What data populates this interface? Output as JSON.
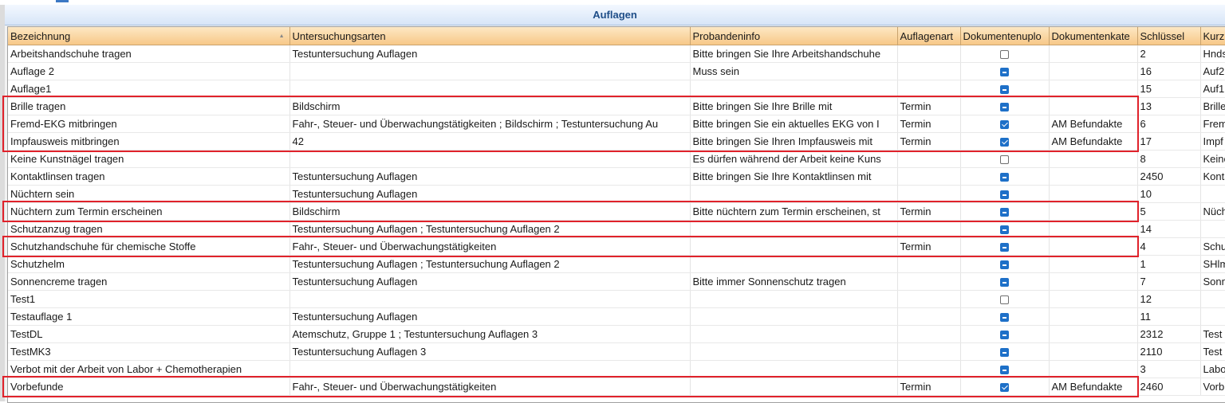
{
  "panel": {
    "title": "Auflagen"
  },
  "columns": [
    "Bezeichnung",
    "Untersuchungsarten",
    "Probandeninfo",
    "Auflagenart",
    "Dokumentenuplo",
    "Dokumentenkate",
    "Schlüssel",
    "Kurz"
  ],
  "sort": {
    "column": "Bezeichnung",
    "direction": "ascending"
  },
  "colors": {
    "highlight_border": "#e0222b",
    "header_bg": "#f7c888",
    "checkbox_accent": "#1e70c8"
  },
  "rows": [
    {
      "bezeichnung": "Arbeitshandschuhe tragen",
      "untersuchungsarten": "Testuntersuchung Auflagen",
      "probandeninfo": "Bitte bringen Sie Ihre Arbeitshandschuhe",
      "auflagenart": "",
      "upload": "unchecked",
      "kategorie": "",
      "schluessel": "2",
      "kurz": "Hnds",
      "highlighted": false
    },
    {
      "bezeichnung": "Auflage 2",
      "untersuchungsarten": "",
      "probandeninfo": "Muss sein",
      "auflagenart": "",
      "upload": "indeterminate",
      "kategorie": "",
      "schluessel": "16",
      "kurz": "Auf2",
      "highlighted": false
    },
    {
      "bezeichnung": "Auflage1",
      "untersuchungsarten": "",
      "probandeninfo": "",
      "auflagenart": "",
      "upload": "indeterminate",
      "kategorie": "",
      "schluessel": "15",
      "kurz": "Auf1",
      "highlighted": false
    },
    {
      "bezeichnung": "Brille tragen",
      "untersuchungsarten": "Bildschirm",
      "probandeninfo": "Bitte bringen Sie Ihre Brille mit",
      "auflagenart": "Termin",
      "upload": "indeterminate",
      "kategorie": "",
      "schluessel": "13",
      "kurz": "Brille",
      "highlighted": true
    },
    {
      "bezeichnung": "Fremd-EKG mitbringen",
      "untersuchungsarten": "Fahr-, Steuer- und Überwachungstätigkeiten ; Bildschirm ; Testuntersuchung Au",
      "probandeninfo": "Bitte bringen Sie ein aktuelles EKG von I",
      "auflagenart": "Termin",
      "upload": "checked",
      "kategorie": "AM Befundakte",
      "schluessel": "6",
      "kurz": "Frem",
      "highlighted": true
    },
    {
      "bezeichnung": "Impfausweis mitbringen",
      "untersuchungsarten": "42",
      "probandeninfo": "Bitte bringen Sie Ihren Impfausweis mit",
      "auflagenart": "Termin",
      "upload": "checked",
      "kategorie": "AM Befundakte",
      "schluessel": "17",
      "kurz": "Impf",
      "highlighted": true
    },
    {
      "bezeichnung": "Keine Kunstnägel tragen",
      "untersuchungsarten": "",
      "probandeninfo": "Es dürfen während der Arbeit keine Kuns",
      "auflagenart": "",
      "upload": "unchecked",
      "kategorie": "",
      "schluessel": "8",
      "kurz": "Keine",
      "highlighted": false
    },
    {
      "bezeichnung": "Kontaktlinsen tragen",
      "untersuchungsarten": "Testuntersuchung Auflagen",
      "probandeninfo": "Bitte bringen Sie Ihre Kontaktlinsen mit",
      "auflagenart": "",
      "upload": "indeterminate",
      "kategorie": "",
      "schluessel": "2450",
      "kurz": "Konta",
      "highlighted": false
    },
    {
      "bezeichnung": "Nüchtern sein",
      "untersuchungsarten": "Testuntersuchung Auflagen",
      "probandeninfo": "",
      "auflagenart": "",
      "upload": "indeterminate",
      "kategorie": "",
      "schluessel": "10",
      "kurz": "",
      "highlighted": false
    },
    {
      "bezeichnung": "Nüchtern zum Termin erscheinen",
      "untersuchungsarten": "Bildschirm",
      "probandeninfo": "Bitte nüchtern zum Termin erscheinen, st",
      "auflagenart": "Termin",
      "upload": "indeterminate",
      "kategorie": "",
      "schluessel": "5",
      "kurz": "Nüch",
      "highlighted": true
    },
    {
      "bezeichnung": "Schutzanzug tragen",
      "untersuchungsarten": "Testuntersuchung Auflagen ; Testuntersuchung Auflagen 2",
      "probandeninfo": "",
      "auflagenart": "",
      "upload": "indeterminate",
      "kategorie": "",
      "schluessel": "14",
      "kurz": "",
      "highlighted": false
    },
    {
      "bezeichnung": "Schutzhandschuhe für chemische Stoffe",
      "untersuchungsarten": "Fahr-, Steuer- und Überwachungstätigkeiten",
      "probandeninfo": "",
      "auflagenart": "Termin",
      "upload": "indeterminate",
      "kategorie": "",
      "schluessel": "4",
      "kurz": "Schu",
      "highlighted": true
    },
    {
      "bezeichnung": "Schutzhelm",
      "untersuchungsarten": "Testuntersuchung Auflagen ; Testuntersuchung Auflagen 2",
      "probandeninfo": "",
      "auflagenart": "",
      "upload": "indeterminate",
      "kategorie": "",
      "schluessel": "1",
      "kurz": "SHlm",
      "highlighted": false
    },
    {
      "bezeichnung": "Sonnencreme tragen",
      "untersuchungsarten": "Testuntersuchung Auflagen",
      "probandeninfo": "Bitte immer Sonnenschutz tragen",
      "auflagenart": "",
      "upload": "indeterminate",
      "kategorie": "",
      "schluessel": "7",
      "kurz": "Sonn",
      "highlighted": false
    },
    {
      "bezeichnung": "Test1",
      "untersuchungsarten": "",
      "probandeninfo": "",
      "auflagenart": "",
      "upload": "unchecked",
      "kategorie": "",
      "schluessel": "12",
      "kurz": "",
      "highlighted": false
    },
    {
      "bezeichnung": "Testauflage 1",
      "untersuchungsarten": "Testuntersuchung Auflagen",
      "probandeninfo": "",
      "auflagenart": "",
      "upload": "indeterminate",
      "kategorie": "",
      "schluessel": "11",
      "kurz": "",
      "highlighted": false
    },
    {
      "bezeichnung": "TestDL",
      "untersuchungsarten": "Atemschutz, Gruppe 1 ; Testuntersuchung Auflagen 3",
      "probandeninfo": "",
      "auflagenart": "",
      "upload": "indeterminate",
      "kategorie": "",
      "schluessel": "2312",
      "kurz": "Test",
      "highlighted": false
    },
    {
      "bezeichnung": "TestMK3",
      "untersuchungsarten": "Testuntersuchung Auflagen 3",
      "probandeninfo": "",
      "auflagenart": "",
      "upload": "indeterminate",
      "kategorie": "",
      "schluessel": "2110",
      "kurz": "Test",
      "highlighted": false
    },
    {
      "bezeichnung": "Verbot mit der Arbeit von Labor + Chemotherapien",
      "untersuchungsarten": "",
      "probandeninfo": "",
      "auflagenart": "",
      "upload": "indeterminate",
      "kategorie": "",
      "schluessel": "3",
      "kurz": "Labo",
      "highlighted": false
    },
    {
      "bezeichnung": "Vorbefunde",
      "untersuchungsarten": "Fahr-, Steuer- und Überwachungstätigkeiten",
      "probandeninfo": "",
      "auflagenart": "Termin",
      "upload": "checked",
      "kategorie": "AM Befundakte",
      "schluessel": "2460",
      "kurz": "Vorb",
      "highlighted": true
    }
  ]
}
